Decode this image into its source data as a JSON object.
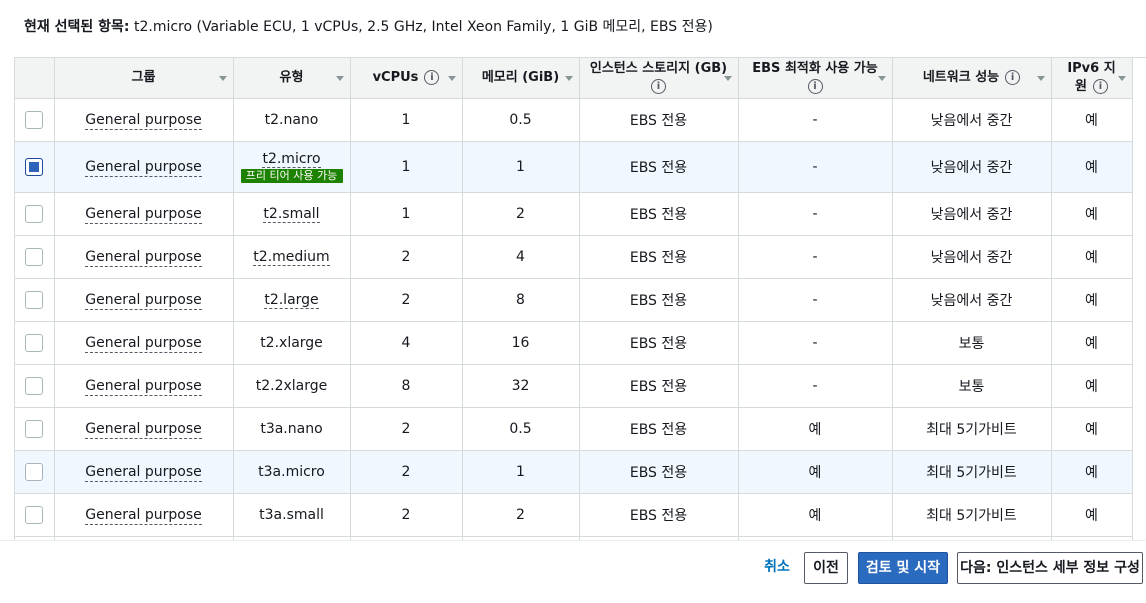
{
  "summary": {
    "label": "현재 선택된 항목:",
    "value": "t2.micro (Variable ECU, 1 vCPUs, 2.5 GHz, Intel Xeon Family, 1 GiB 메모리, EBS 전용)"
  },
  "columns": {
    "group": "그룹",
    "type": "유형",
    "vcpus": "vCPUs",
    "memory": "메모리 (GiB)",
    "storage": "인스턴스 스토리지 (GB)",
    "ebs": "EBS 최적화 사용 가능",
    "network": "네트워크 성능",
    "ipv6_line1": "IPv6 지",
    "ipv6_line2": "원"
  },
  "info_glyph": "i",
  "free_tier_badge": "프리 티어 사용 가능",
  "rows": [
    {
      "checked": false,
      "group": "General purpose",
      "type": "t2.nano",
      "vcpus": "1",
      "memory": "0.5",
      "storage": "EBS 전용",
      "ebs": "-",
      "network": "낮음에서 중간",
      "ipv6": "예"
    },
    {
      "checked": true,
      "group": "General purpose",
      "type": "t2.micro",
      "vcpus": "1",
      "memory": "1",
      "storage": "EBS 전용",
      "ebs": "-",
      "network": "낮음에서 중간",
      "ipv6": "예"
    },
    {
      "checked": false,
      "group": "General purpose",
      "type": "t2.small",
      "vcpus": "1",
      "memory": "2",
      "storage": "EBS 전용",
      "ebs": "-",
      "network": "낮음에서 중간",
      "ipv6": "예"
    },
    {
      "checked": false,
      "group": "General purpose",
      "type": "t2.medium",
      "vcpus": "2",
      "memory": "4",
      "storage": "EBS 전용",
      "ebs": "-",
      "network": "낮음에서 중간",
      "ipv6": "예"
    },
    {
      "checked": false,
      "group": "General purpose",
      "type": "t2.large",
      "vcpus": "2",
      "memory": "8",
      "storage": "EBS 전용",
      "ebs": "-",
      "network": "낮음에서 중간",
      "ipv6": "예"
    },
    {
      "checked": false,
      "group": "General purpose",
      "type": "t2.xlarge",
      "vcpus": "4",
      "memory": "16",
      "storage": "EBS 전용",
      "ebs": "-",
      "network": "보통",
      "ipv6": "예"
    },
    {
      "checked": false,
      "group": "General purpose",
      "type": "t2.2xlarge",
      "vcpus": "8",
      "memory": "32",
      "storage": "EBS 전용",
      "ebs": "-",
      "network": "보통",
      "ipv6": "예"
    },
    {
      "checked": false,
      "group": "General purpose",
      "type": "t3a.nano",
      "vcpus": "2",
      "memory": "0.5",
      "storage": "EBS 전용",
      "ebs": "예",
      "network": "최대 5기가비트",
      "ipv6": "예"
    },
    {
      "checked": false,
      "group": "General purpose",
      "type": "t3a.micro",
      "vcpus": "2",
      "memory": "1",
      "storage": "EBS 전용",
      "ebs": "예",
      "network": "최대 5기가비트",
      "ipv6": "예"
    },
    {
      "checked": false,
      "group": "General purpose",
      "type": "t3a.small",
      "vcpus": "2",
      "memory": "2",
      "storage": "EBS 전용",
      "ebs": "예",
      "network": "최대 5기가비트",
      "ipv6": "예"
    }
  ],
  "footer": {
    "cancel": "취소",
    "previous": "이전",
    "review_launch": "검토 및 시작",
    "next": "다음: 인스턴스 세부 정보 구성"
  },
  "colors": {
    "primary_button": "#2b6bbf",
    "free_tier_badge": "#1d8102",
    "link": "#0073bb",
    "selected_row": "#f1f7fe"
  }
}
